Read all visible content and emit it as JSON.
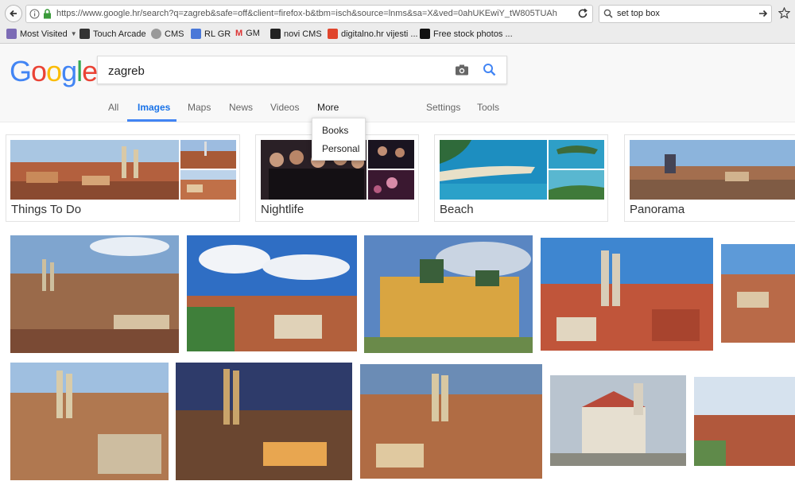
{
  "browser": {
    "url": "https://www.google.hr/search?q=zagreb&safe=off&client=firefox-b&tbm=isch&source=lnms&sa=X&ved=0ahUKEwiY_tW805TUAhXFKs",
    "search_value": "set top box",
    "bookmarks": [
      "Most Visited",
      "Touch Arcade",
      "CMS",
      "RL GR",
      "GM",
      "novi CMS",
      "digitalno.hr vijesti ...",
      "Free stock photos ..."
    ]
  },
  "google": {
    "query": "zagreb",
    "tabs": [
      "All",
      "Images",
      "Maps",
      "News",
      "Videos",
      "More",
      "Settings",
      "Tools"
    ],
    "active_tab": "Images",
    "more_menu": [
      "Books",
      "Personal"
    ]
  },
  "topics": [
    "Things To Do",
    "Nightlife",
    "Beach",
    "Panorama"
  ],
  "colors": {
    "accent": "#4285f4",
    "logo_blue": "#4285F4",
    "logo_red": "#EA4335",
    "logo_yellow": "#FBBC05",
    "logo_green": "#34A853"
  }
}
